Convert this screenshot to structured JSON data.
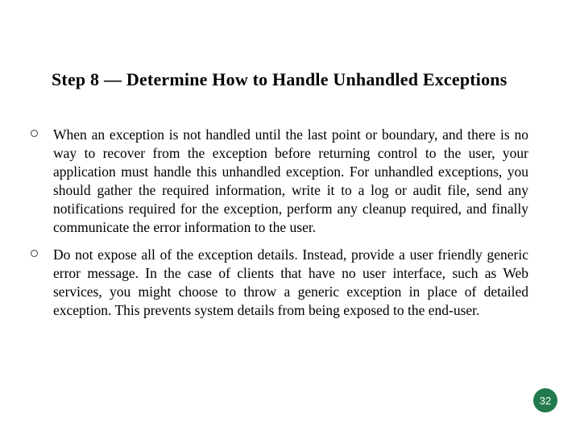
{
  "slide": {
    "title": "Step 8 — Determine How to Handle Unhandled Exceptions",
    "bullets": [
      "When an exception is not handled until the last point or boundary, and there is no way to recover from the exception before returning control to the user, your application must handle this unhandled exception. For unhandled exceptions, you should gather the required information, write it to a log or audit file, send any notifications required for the exception, perform any cleanup required, and finally communicate the error information to the user.",
      "Do not expose all of the exception details. Instead, provide a user friendly generic error message. In the case of clients that have no user interface, such as Web services, you might choose to throw a generic exception in place of detailed exception. This prevents system details from being exposed to the end-user."
    ],
    "page_number": "32"
  },
  "colors": {
    "badge_bg": "#227a4b",
    "badge_fg": "#ffffff"
  }
}
